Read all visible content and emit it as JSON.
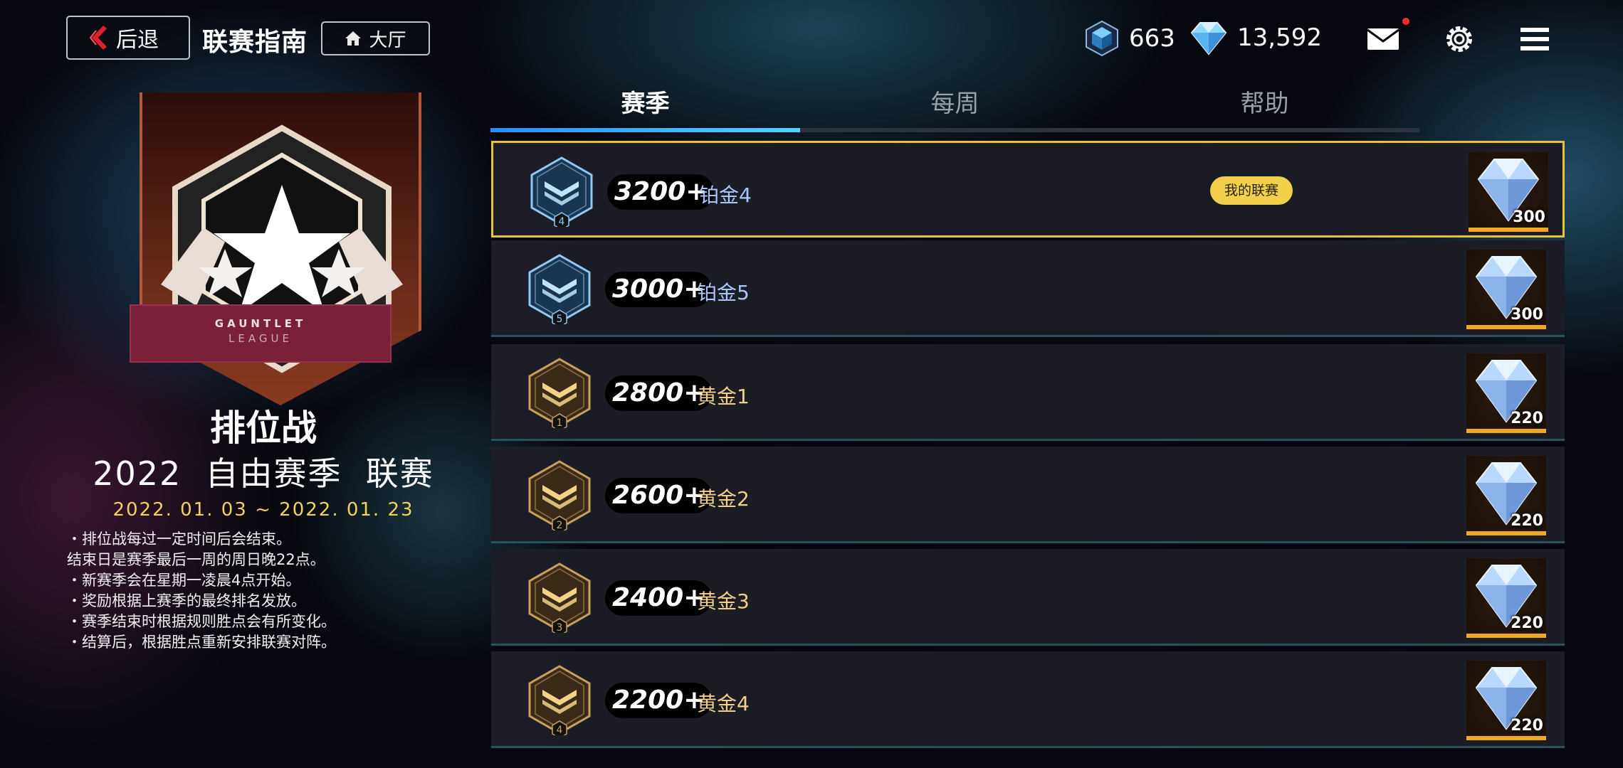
{
  "header": {
    "back_label": "后退",
    "title": "联赛指南",
    "lobby_label": "大厅",
    "currency_cube": "663",
    "currency_crystal": "13,592",
    "icons": [
      "back-chevron-icon",
      "home-icon",
      "cube-currency-icon",
      "crystal-currency-icon",
      "mail-icon",
      "gear-icon",
      "menu-icon"
    ],
    "accent_color": "#e7c23c"
  },
  "league": {
    "emblem_line1": "GAUNTLET",
    "emblem_line2": "LEAGUE",
    "mode": "排位战",
    "season": "2022  自由赛季  联赛",
    "dates": "2022. 01. 03 ~ 2022. 01. 23",
    "notes": [
      "・排位战每过一定时间后会结束。",
      "结束日是赛季最后一周的周日晚22点。",
      "・新赛季会在星期一凌晨4点开始。",
      "・奖励根据上赛季的最终排名发放。",
      "・赛季结束时根据规则胜点会有所变化。",
      "・结算后，根据胜点重新安排联赛对阵。"
    ]
  },
  "tabs": [
    {
      "label": "赛季",
      "active": true
    },
    {
      "label": "每周",
      "active": false
    },
    {
      "label": "帮助",
      "active": false
    }
  ],
  "my_league_label": "我的联赛",
  "tiers": [
    {
      "score": "3200+",
      "name": "铂金4",
      "level": "4",
      "reward": "300",
      "current": true
    },
    {
      "score": "3000+",
      "name": "铂金5",
      "level": "5",
      "reward": "300",
      "current": false
    },
    {
      "score": "2800+",
      "name": "黄金1",
      "level": "1",
      "reward": "220",
      "current": false
    },
    {
      "score": "2600+",
      "name": "黄金2",
      "level": "2",
      "reward": "220",
      "current": false
    },
    {
      "score": "2400+",
      "name": "黄金3",
      "level": "3",
      "reward": "220",
      "current": false
    },
    {
      "score": "2200+",
      "name": "黄金4",
      "level": "4",
      "reward": "220",
      "current": false
    }
  ]
}
